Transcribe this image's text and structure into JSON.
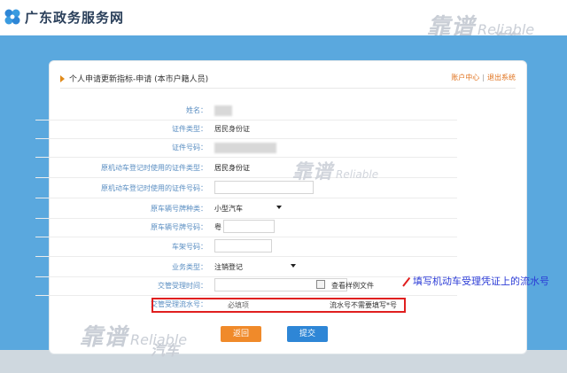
{
  "header": {
    "site_title": "广东政务服务网"
  },
  "watermark": {
    "cn": "靠谱",
    "en": "Reliable",
    "car": "汽车"
  },
  "panel": {
    "title": "个人申请更新指标-申请 (本市户籍人员)",
    "links": {
      "account": "账户中心",
      "separator": "|",
      "logout": "退出系统"
    }
  },
  "form": {
    "name_label": "姓名：",
    "id_type_label": "证件类型：",
    "id_type_value": "居民身份证",
    "id_number_label": "证件号码：",
    "orig_reg_id_type_label": "原机动车登记时使用的证件类型：",
    "orig_reg_id_type_value": "居民身份证",
    "orig_reg_id_number_label": "原机动车登记时使用的证件号码：",
    "plate_type_label": "原车辆号牌种类：",
    "plate_type_value": "小型汽车",
    "plate_number_label": "原车辆号牌号码：",
    "plate_number_prefix": "粤",
    "vin_label": "车架号码：",
    "business_type_label": "业务类型：",
    "business_type_value": "注销登记",
    "accept_time_label": "交管受理时间：",
    "view_sample": "查看样例文件",
    "serial_label": "交管受理流水号：",
    "serial_placeholder": "必填项",
    "serial_hint": "流水号不需要填写*号"
  },
  "annotation": "填写机动车受理凭证上的流水号",
  "buttons": {
    "back": "返回",
    "submit": "提交"
  },
  "colors": {
    "accent_orange": "#f08a2a",
    "accent_blue": "#2e86d6",
    "highlight_red": "#e01f1f",
    "label_blue": "#5a8ec2"
  }
}
